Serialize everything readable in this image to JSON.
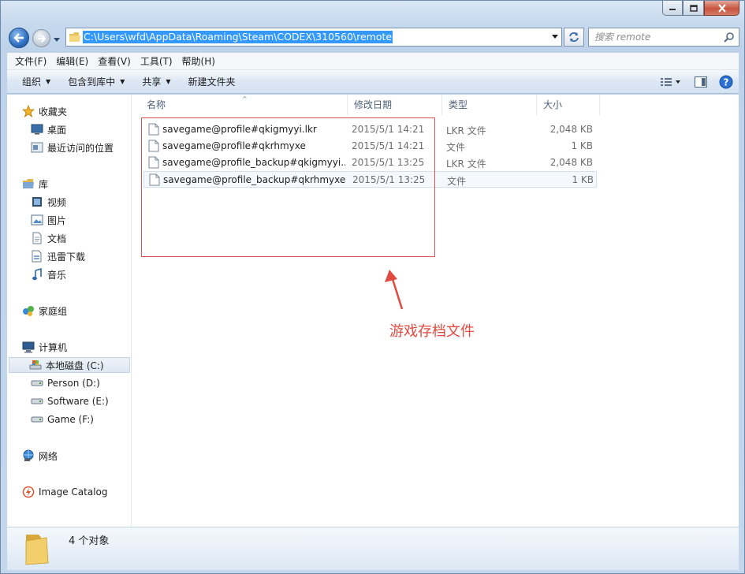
{
  "window": {
    "controls": [
      "minimize",
      "maximize",
      "close"
    ]
  },
  "address": {
    "path": "C:\\Users\\wfd\\AppData\\Roaming\\Steam\\CODEX\\310560\\remote"
  },
  "search": {
    "placeholder": "搜索 remote"
  },
  "menu": {
    "file": "文件(F)",
    "edit": "编辑(E)",
    "view": "查看(V)",
    "tools": "工具(T)",
    "help": "帮助(H)"
  },
  "commands": {
    "organize": "组织",
    "include_in_library": "包含到库中",
    "share": "共享",
    "new_folder": "新建文件夹"
  },
  "nav": {
    "favorites": "收藏夹",
    "desktop": "桌面",
    "recent": "最近访问的位置",
    "libraries": "库",
    "videos": "视频",
    "pictures": "图片",
    "documents": "文档",
    "xunlei": "迅雷下载",
    "music": "音乐",
    "homegroup": "家庭组",
    "computer": "计算机",
    "drive_c": "本地磁盘 (C:)",
    "drive_d": "Person (D:)",
    "drive_e": "Software (E:)",
    "drive_f": "Game (F:)",
    "network": "网络",
    "image_catalog": "Image Catalog"
  },
  "columns": {
    "name": "名称",
    "date": "修改日期",
    "type": "类型",
    "size": "大小"
  },
  "files": [
    {
      "name": "savegame@profile#qkigmyyi.lkr",
      "date": "2015/5/1 14:21",
      "type": "LKR 文件",
      "size": "2,048 KB"
    },
    {
      "name": "savegame@profile#qkrhmyxe",
      "date": "2015/5/1 14:21",
      "type": "文件",
      "size": "1 KB"
    },
    {
      "name": "savegame@profile_backup#qkigmyyi...",
      "date": "2015/5/1 13:25",
      "type": "LKR 文件",
      "size": "2,048 KB"
    },
    {
      "name": "savegame@profile_backup#qkrhmyxe",
      "date": "2015/5/1 13:25",
      "type": "文件",
      "size": "1 KB"
    }
  ],
  "annotation": {
    "label": "游戏存档文件",
    "color": "#e04a3f"
  },
  "status": {
    "count": "4 个对象"
  },
  "colors": {
    "selection": "#3399ff",
    "frame": "#c6d9ee",
    "highlight": "#d9534f"
  }
}
